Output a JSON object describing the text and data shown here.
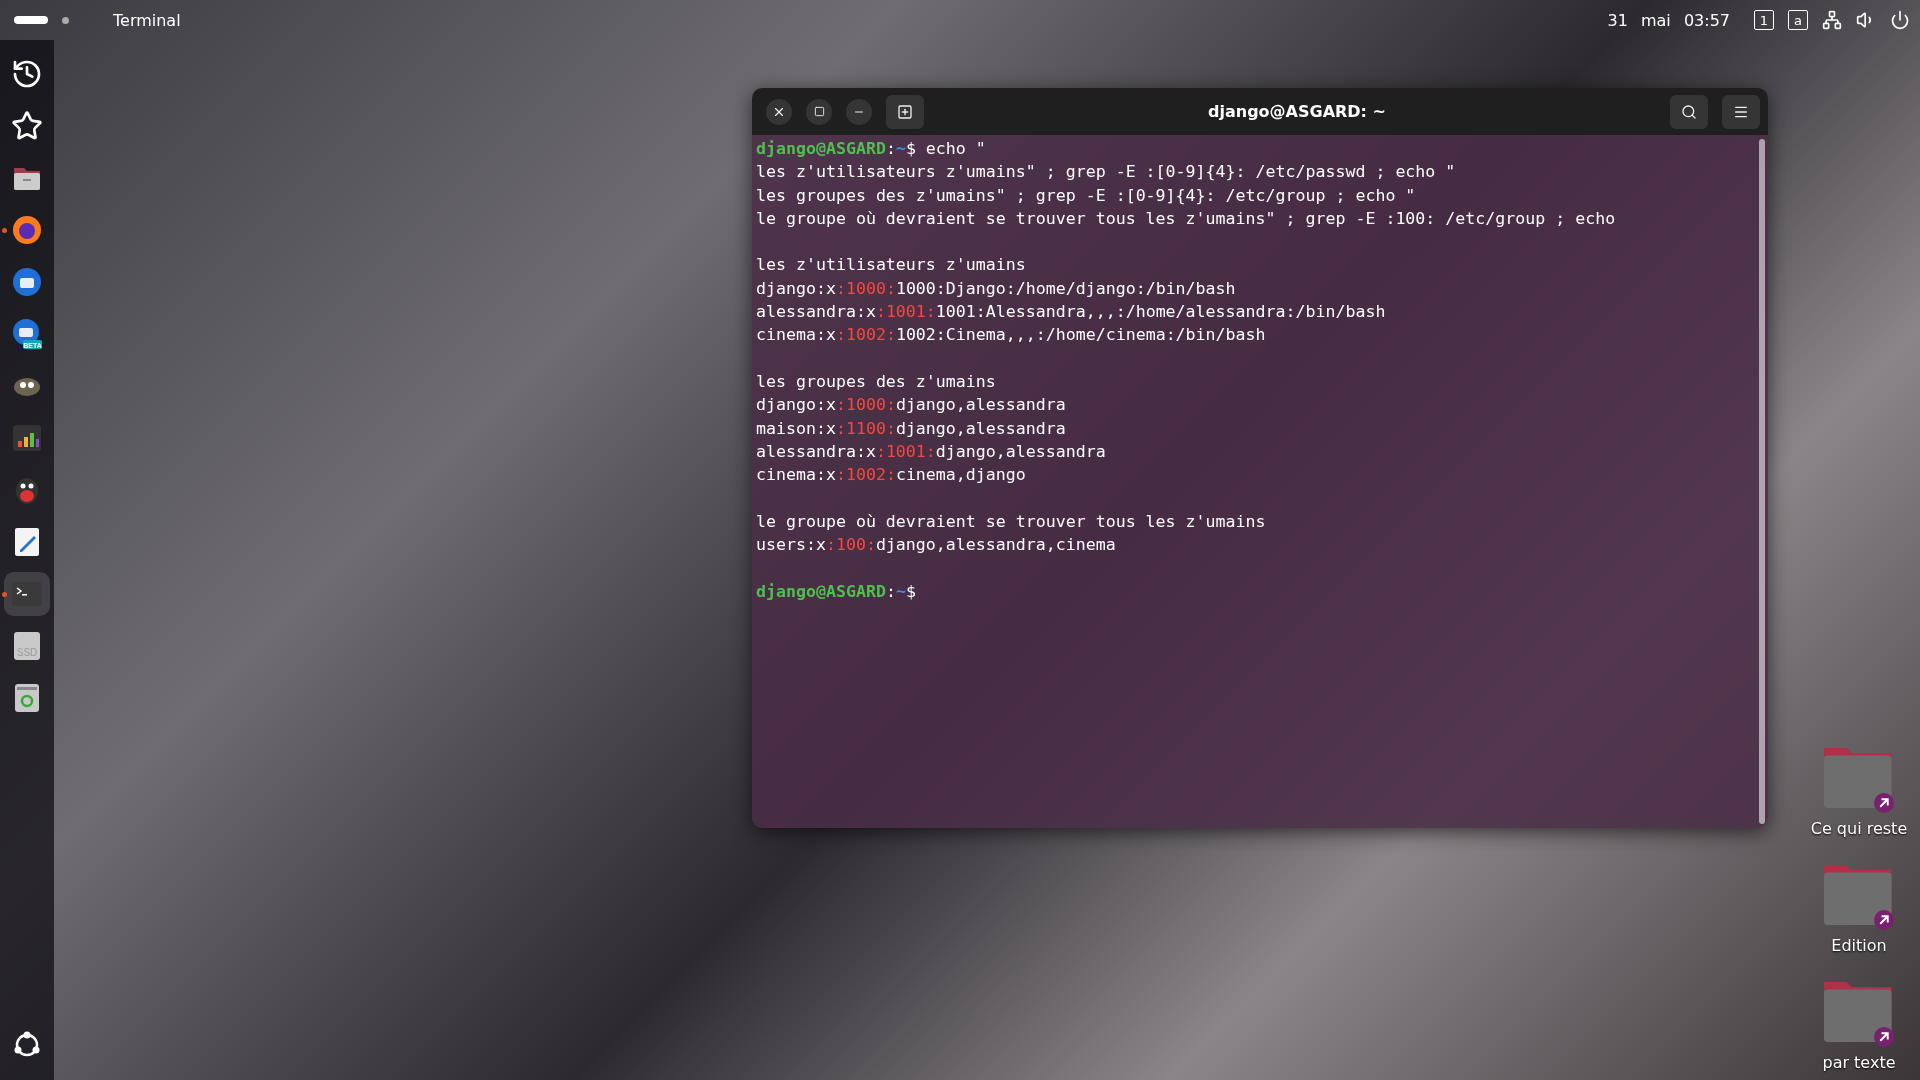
{
  "top_bar": {
    "app_name": "Terminal",
    "date": "31 mai",
    "time": "03:57",
    "indicators": [
      {
        "kind": "keyboard",
        "text": "1"
      },
      {
        "kind": "keyboard",
        "text": "a"
      },
      {
        "kind": "network"
      },
      {
        "kind": "volume"
      },
      {
        "kind": "power"
      }
    ]
  },
  "dock": {
    "items": [
      {
        "kind": "recent",
        "running": false,
        "selected": false
      },
      {
        "kind": "starred",
        "running": false,
        "selected": false
      },
      {
        "kind": "files",
        "running": false,
        "selected": false
      },
      {
        "kind": "browser",
        "running": true,
        "selected": false
      },
      {
        "kind": "mail",
        "running": false,
        "selected": false
      },
      {
        "kind": "mail-beta",
        "badge": "BETA",
        "running": false,
        "selected": false
      },
      {
        "kind": "gimp",
        "running": false,
        "selected": false
      },
      {
        "kind": "equalizer",
        "running": false,
        "selected": false
      },
      {
        "kind": "penguin",
        "running": false,
        "selected": false
      },
      {
        "kind": "editor",
        "running": false,
        "selected": false
      },
      {
        "kind": "terminal",
        "running": true,
        "selected": true
      },
      {
        "kind": "drive",
        "label": "SSD",
        "running": false,
        "selected": false
      },
      {
        "kind": "trash",
        "running": false,
        "selected": false
      }
    ]
  },
  "terminal": {
    "title": "django@ASGARD: ~",
    "lines": [
      {
        "kind": "prompt",
        "user": "django@ASGARD",
        "sep": ":",
        "path": "~",
        "sign": "$",
        "command": "echo \""
      },
      {
        "kind": "output",
        "text": "les z'utilisateurs z'umains\" ; grep -E :[0-9]{4}: /etc/passwd ; echo \""
      },
      {
        "kind": "output",
        "text": "les groupes des z'umains\" ; grep -E :[0-9]{4}: /etc/group ; echo \""
      },
      {
        "kind": "output",
        "text": "le groupe où devraient se trouver tous les z'umains\" ; grep -E :100: /etc/group ; echo"
      },
      {
        "kind": "blank"
      },
      {
        "kind": "output",
        "text": "les z'utilisateurs z'umains"
      },
      {
        "kind": "match",
        "head": "django:x",
        "match": ":1000:",
        "tail": "1000:Django:/home/django:/bin/bash"
      },
      {
        "kind": "match",
        "head": "alessandra:x",
        "match": ":1001:",
        "tail": "1001:Alessandra,,,:/home/alessandra:/bin/bash"
      },
      {
        "kind": "match",
        "head": "cinema:x",
        "match": ":1002:",
        "tail": "1002:Cinema,,,:/home/cinema:/bin/bash"
      },
      {
        "kind": "blank"
      },
      {
        "kind": "output",
        "text": "les groupes des z'umains"
      },
      {
        "kind": "match",
        "head": "django:x",
        "match": ":1000:",
        "tail": "django,alessandra"
      },
      {
        "kind": "match",
        "head": "maison:x",
        "match": ":1100:",
        "tail": "django,alessandra"
      },
      {
        "kind": "match",
        "head": "alessandra:x",
        "match": ":1001:",
        "tail": "django,alessandra"
      },
      {
        "kind": "match",
        "head": "cinema:x",
        "match": ":1002:",
        "tail": "cinema,django"
      },
      {
        "kind": "blank"
      },
      {
        "kind": "output",
        "text": "le groupe où devraient se trouver tous les z'umains"
      },
      {
        "kind": "match",
        "head": "users:x",
        "match": ":100:",
        "tail": "django,alessandra,cinema"
      },
      {
        "kind": "blank"
      },
      {
        "kind": "prompt",
        "user": "django@ASGARD",
        "sep": ":",
        "path": "~",
        "sign": "$"
      }
    ]
  },
  "desktop_icons": [
    {
      "label": "Ce qui reste"
    },
    {
      "label": "Edition"
    },
    {
      "label": "par texte"
    }
  ]
}
